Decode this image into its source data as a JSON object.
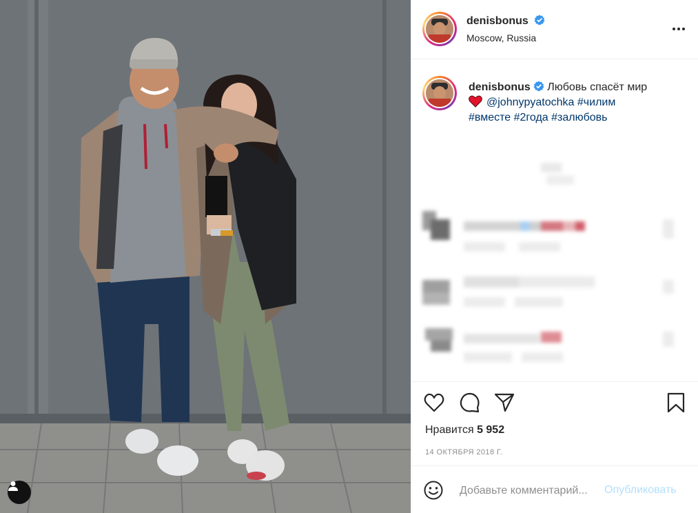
{
  "post": {
    "username": "denisbonus",
    "location": "Moscow, Russia"
  },
  "caption": {
    "username": "denisbonus",
    "text": "Любовь спасёт мир",
    "mention": "@johnypyatochka",
    "hashtags_line1": "#чилим",
    "hashtags_line2": "#вместе #2года #залюбовь"
  },
  "likes": {
    "label": "Нравится",
    "count": "5 952"
  },
  "date": "14 ОКТЯБРЯ 2018 Г.",
  "comment": {
    "placeholder": "Добавьте комментарий...",
    "publish_label": "Опубликовать"
  },
  "icons": {
    "like": "heart-icon",
    "comment": "comment-icon",
    "share": "share-icon",
    "save": "bookmark-icon",
    "more": "more-icon",
    "emoji": "emoji-icon",
    "user_tag": "user-tag-icon",
    "verified": "verified-badge-icon"
  },
  "colors": {
    "link": "#00376b",
    "verified": "#3897f0",
    "publish_disabled": "#b2dffc",
    "muted": "#8e8e8e"
  }
}
